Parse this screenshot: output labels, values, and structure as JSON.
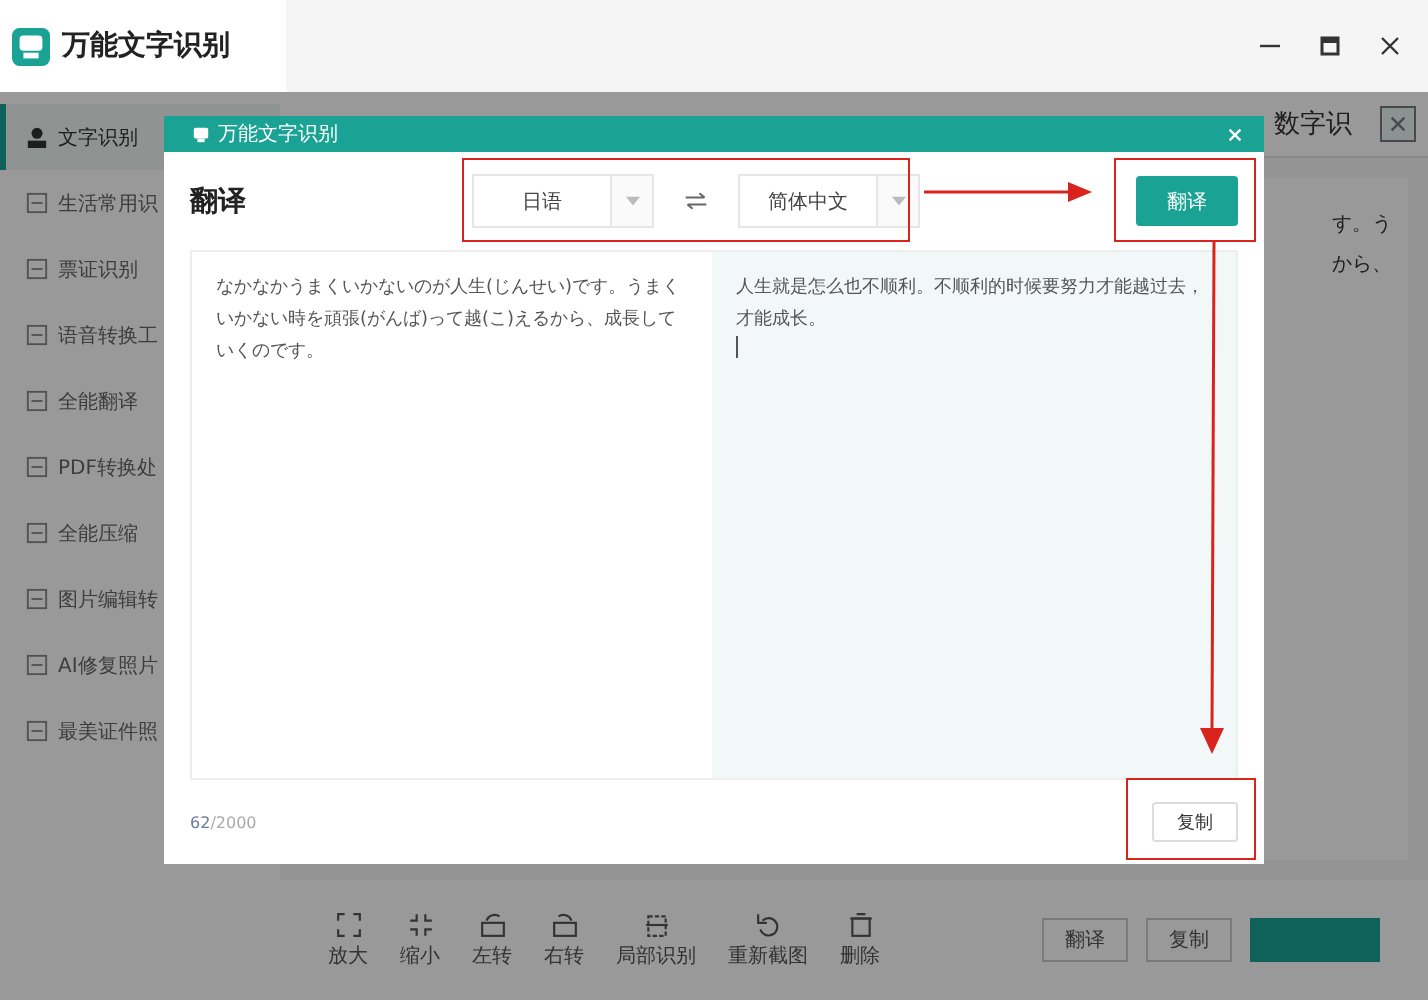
{
  "app": {
    "title": "万能文字识别"
  },
  "sidebar": {
    "items": [
      {
        "label": "文字识别",
        "selected": true
      },
      {
        "label": "生活常用识",
        "selected": false
      },
      {
        "label": "票证识别",
        "selected": false
      },
      {
        "label": "语音转换工",
        "selected": false
      },
      {
        "label": "全能翻译",
        "selected": false
      },
      {
        "label": "PDF转换处",
        "selected": false
      },
      {
        "label": "全能压缩",
        "selected": false
      },
      {
        "label": "图片编辑转",
        "selected": false
      },
      {
        "label": "AI修复照片",
        "selected": false
      },
      {
        "label": "最美证件照",
        "selected": false
      }
    ]
  },
  "top_tabs": [
    "数字识"
  ],
  "background_text": [
    "す。う",
    "から、"
  ],
  "toolbar": [
    "放大",
    "缩小",
    "左转",
    "右转",
    "局部识别",
    "重新截图",
    "删除"
  ],
  "bottom_buttons": [
    "翻译",
    "复制"
  ],
  "dialog": {
    "title": "万能文字识别",
    "heading": "翻译",
    "source_language": "日语",
    "target_language": "简体中文",
    "translate_button": "翻译",
    "source_text": "なかなかうまくいかないのが人生(じんせい)です。うまくいかない時を頑張(がんば)って越(こ)えるから、成長していくのです。",
    "translated_text": "人生就是怎么也不顺利。不顺利的时候要努力才能越过去，才能成长。",
    "char_count": "62",
    "char_limit": "/2000",
    "copy_button": "复制"
  }
}
